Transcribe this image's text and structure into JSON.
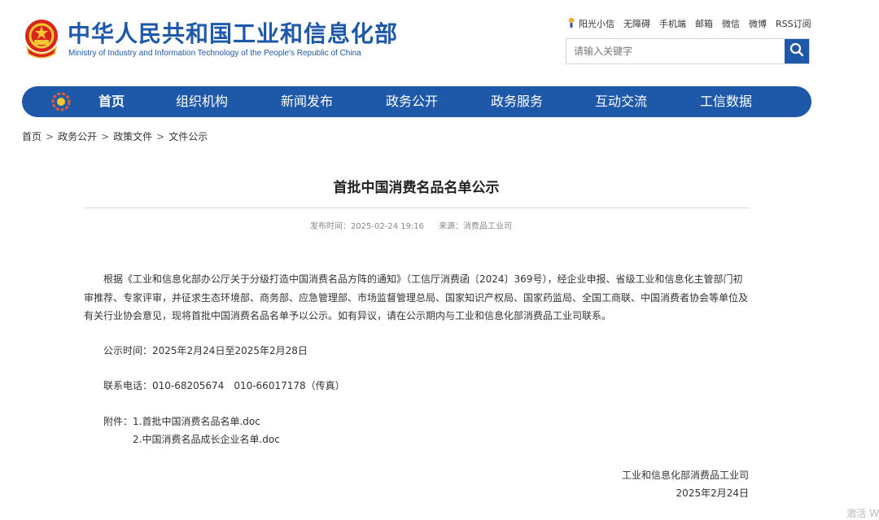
{
  "header": {
    "title": "中华人民共和国工业和信息化部",
    "subtitle": "Ministry of Industry and Information Technology of the People's Republic of China",
    "emblem_icon": "national-emblem-icon",
    "top_links": [
      "阳光小信",
      "无障碍",
      "手机端",
      "邮箱",
      "微信",
      "微博",
      "RSS订阅"
    ],
    "search": {
      "placeholder": "请输入关键字",
      "value": ""
    }
  },
  "nav": {
    "items": [
      "首页",
      "组织机构",
      "新闻发布",
      "政务公开",
      "政务服务",
      "互动交流",
      "工信数据"
    ],
    "active": "首页",
    "color": "#1e58a8"
  },
  "breadcrumb": [
    "首页",
    "政务公开",
    "政策文件",
    "文件公示"
  ],
  "article": {
    "title": "首批中国消费名品名单公示",
    "publish_time": "发布时间：2025-02-24 19:16",
    "source": "来源：消费品工业司",
    "body": "根据《工业和信息化部办公厅关于分级打造中国消费名品方阵的通知》（工信厅消费函〔2024〕369号），经企业申报、省级工业和信息化主管部门初审推荐、专家评审，并征求生态环境部、商务部、应急管理部、市场监督管理总局、国家知识产权局、国家药监局、全国工商联、中国消费者协会等单位及有关行业协会意见，现将首批中国消费名品名单予以公示。如有异议，请在公示期内与工业和信息化部消费品工业司联系。",
    "notice_period": "公示时间：2025年2月24日至2025年2月28日",
    "contact": "联系电话：010-68205674　010-66017178（传真）",
    "attachments_label": "附件：",
    "attachments": [
      "1.首批中国消费名品名单.doc",
      "2.中国消费名品成长企业名单.doc"
    ],
    "signature": "工业和信息化部消费品工业司",
    "date": "2025年2月24日"
  },
  "watermark": "激活 W"
}
